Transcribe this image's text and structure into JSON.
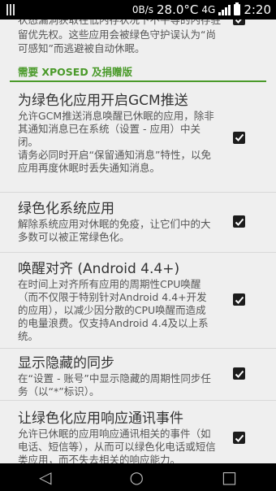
{
  "status_bar": {
    "speed": "0B/s",
    "temperature": "28.0°C",
    "network": "4G",
    "time": "2:20"
  },
  "top_partial": {
    "text": "状态漏洞获取在低内存状况下不平等的内存驻留优先权。这些应用会被绿色守护误认为“尚可感知”而逃避被自动休眠。"
  },
  "section": {
    "header": "需要 XPOSED 及捐赠版"
  },
  "prefs": [
    {
      "title": "为绿色化应用开启GCM推送",
      "summary": "允许GCM推送消息唤醒已休眠的应用，除非其通知消息已在系统（设置 - 应用）中关闭。\n请务必同时开启“保留通知消息”特性，以免应用再度休眠时丢失通知消息。",
      "checked": true
    },
    {
      "title": "绿色化系统应用",
      "summary": "解除系统应用对休眠的免疫，让它们中的大多数可以被正常绿色化。",
      "checked": true
    },
    {
      "title": "唤醒对齐 (Android 4.4+)",
      "summary": "在时间上对齐所有应用的周期性CPU唤醒（而不仅限于特别针对Android 4.4+开发的应用），以减少因分散的CPU唤醒而造成的电量浪费。仅支持Android 4.4及以上系统。",
      "checked": true
    },
    {
      "title": "显示隐藏的同步",
      "summary": "在“设置 - 账号”中显示隐藏的周期性同步任务（以“*”标识）。",
      "checked": true
    },
    {
      "title": "让绿色化应用响应通讯事件",
      "summary": "允许已休眠的应用响应通讯相关的事件（如电话、短信等），从而可以绿色化电话或短信类应用，而不失去相关的响应能力。",
      "checked": true
    }
  ],
  "nav": {
    "back": "◁",
    "home": "○",
    "recents": "□"
  }
}
